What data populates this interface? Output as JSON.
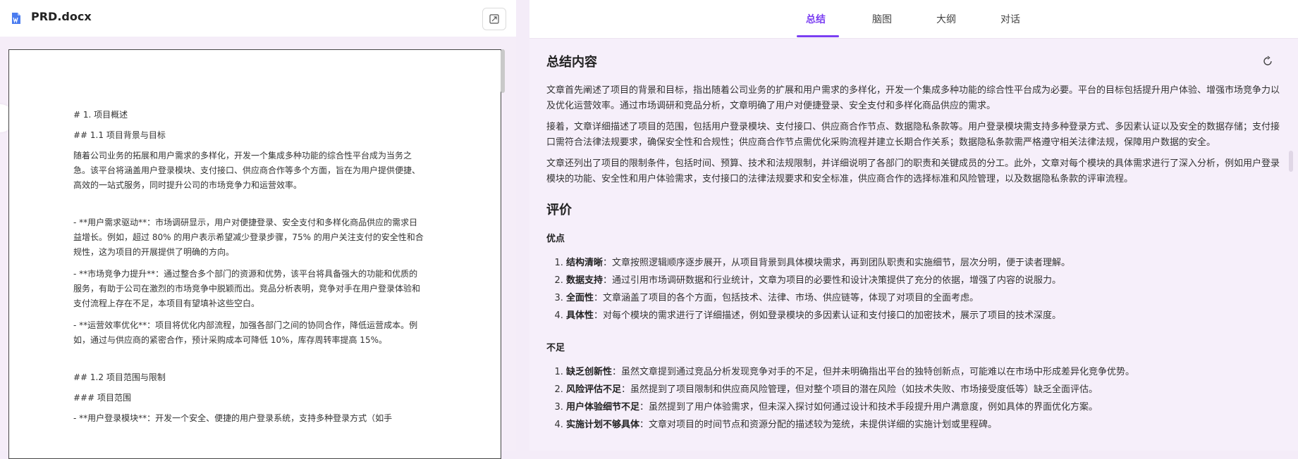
{
  "doc": {
    "title": "PRD.docx",
    "content": {
      "h1": "# 1. 项目概述",
      "h11": "## 1.1 项目背景与目标",
      "p1": "随着公司业务的拓展和用户需求的多样化，开发一个集成多种功能的综合性平台成为当务之急。该平台将涵盖用户登录模块、支付接口、供应商合作等多个方面，旨在为用户提供便捷、高效的一站式服务，同时提升公司的市场竞争力和运营效率。",
      "p2": "- **用户需求驱动**：市场调研显示，用户对便捷登录、安全支付和多样化商品供应的需求日益增长。例如，超过 80% 的用户表示希望减少登录步骤，75% 的用户关注支付的安全性和合规性，这为项目的开展提供了明确的方向。",
      "p3": "- **市场竞争力提升**：通过整合多个部门的资源和优势，该平台将具备强大的功能和优质的服务，有助于公司在激烈的市场竞争中脱颖而出。竞品分析表明，竞争对手在用户登录体验和支付流程上存在不足，本项目有望填补这些空白。",
      "p4": "- **运营效率优化**：项目将优化内部流程，加强各部门之间的协同合作，降低运营成本。例如，通过与供应商的紧密合作，预计采购成本可降低 10%，库存周转率提高 15%。",
      "h12": "## 1.2 项目范围与限制",
      "h13": "### 项目范围",
      "p5": "- **用户登录模块**：开发一个安全、便捷的用户登录系统，支持多种登录方式（如手"
    }
  },
  "tabs": [
    "总结",
    "脑图",
    "大纲",
    "对话"
  ],
  "active_tab": "总结",
  "summary": {
    "heading": "总结内容",
    "p1": "文章首先阐述了项目的背景和目标，指出随着公司业务的扩展和用户需求的多样化，开发一个集成多种功能的综合性平台成为必要。平台的目标包括提升用户体验、增强市场竞争力以及优化运营效率。通过市场调研和竞品分析，文章明确了用户对便捷登录、安全支付和多样化商品供应的需求。",
    "p2": "接着，文章详细描述了项目的范围，包括用户登录模块、支付接口、供应商合作节点、数据隐私条款等。用户登录模块需支持多种登录方式、多因素认证以及安全的数据存储；支付接口需符合法律法规要求，确保安全性和合规性；供应商合作节点需优化采购流程并建立长期合作关系；数据隐私条款需严格遵守相关法律法规，保障用户数据的安全。",
    "p3": "文章还列出了项目的限制条件，包括时间、预算、技术和法规限制，并详细说明了各部门的职责和关键成员的分工。此外，文章对每个模块的具体需求进行了深入分析，例如用户登录模块的功能、安全性和用户体验需求，支付接口的法律法规要求和安全标准，供应商合作的选择标准和风险管理，以及数据隐私条款的评审流程。",
    "eval_heading": "评价",
    "pros_heading": "优点",
    "pros": [
      {
        "k": "结构清晰",
        "v": "：文章按照逻辑顺序逐步展开，从项目背景到具体模块需求，再到团队职责和实施细节，层次分明，便于读者理解。"
      },
      {
        "k": "数据支持",
        "v": "：通过引用市场调研数据和行业统计，文章为项目的必要性和设计决策提供了充分的依据，增强了内容的说服力。"
      },
      {
        "k": "全面性",
        "v": "：文章涵盖了项目的各个方面，包括技术、法律、市场、供应链等，体现了对项目的全面考虑。"
      },
      {
        "k": "具体性",
        "v": "：对每个模块的需求进行了详细描述，例如登录模块的多因素认证和支付接口的加密技术，展示了项目的技术深度。"
      }
    ],
    "cons_heading": "不足",
    "cons": [
      {
        "k": "缺乏创新性",
        "v": "：虽然文章提到通过竞品分析发现竞争对手的不足，但并未明确指出平台的独特创新点，可能难以在市场中形成差异化竞争优势。"
      },
      {
        "k": "风险评估不足",
        "v": "：虽然提到了项目限制和供应商风险管理，但对整个项目的潜在风险（如技术失败、市场接受度低等）缺乏全面评估。"
      },
      {
        "k": "用户体验细节不足",
        "v": "：虽然提到了用户体验需求，但未深入探讨如何通过设计和技术手段提升用户满意度，例如具体的界面优化方案。"
      },
      {
        "k": "实施计划不够具体",
        "v": "：文章对项目的时间节点和资源分配的描述较为笼统，未提供详细的实施计划或里程碑。"
      }
    ]
  },
  "colors": {
    "accent": "#7b3ff2",
    "doc_icon": "#4a7cf0"
  },
  "icons": {
    "doc": "word-doc-icon",
    "expand": "expand-icon",
    "refresh": "refresh-icon"
  }
}
